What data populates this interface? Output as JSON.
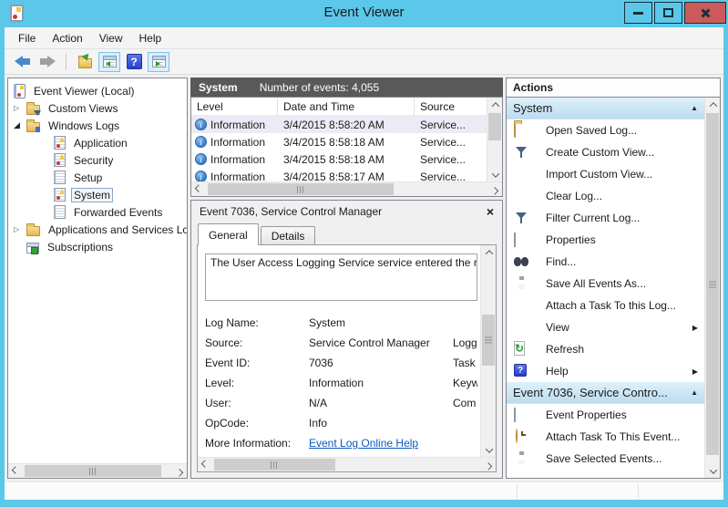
{
  "window": {
    "title": "Event Viewer"
  },
  "menu": {
    "items": [
      "File",
      "Action",
      "View",
      "Help"
    ]
  },
  "toolbar": {
    "icons": [
      "back-icon",
      "forward-icon",
      "export-log-icon",
      "show-console-tree-icon",
      "help-icon",
      "show-action-pane-icon"
    ]
  },
  "glyphs": {
    "expander_collapsed": "▷",
    "expander_expanded": "◢",
    "section_collapse": "▲",
    "submenu_arrow": "▶",
    "close_x": "×"
  },
  "colors": {
    "titlebar_blue": "#5bc8ea",
    "close_red": "#cc5a5a",
    "events_header_gray": "#595959",
    "section_header_blue": "#bcdcf0",
    "link_blue": "#0a59c0",
    "panel_border": "#828790"
  },
  "tree": {
    "items": [
      {
        "label": "Event Viewer (Local)",
        "icon": "event-viewer-icon"
      },
      {
        "label": "Custom Views",
        "icon": "folder-filter-icon",
        "state": "collapsed"
      },
      {
        "label": "Windows Logs",
        "icon": "folder-icon",
        "state": "expanded"
      },
      {
        "label": "Application",
        "icon": "log-icon"
      },
      {
        "label": "Security",
        "icon": "log-icon"
      },
      {
        "label": "Setup",
        "icon": "log-plain-icon"
      },
      {
        "label": "System",
        "icon": "log-icon",
        "selected": true
      },
      {
        "label": "Forwarded Events",
        "icon": "log-plain-icon"
      },
      {
        "label": "Applications and Services Lo",
        "icon": "folder-icon",
        "state": "collapsed"
      },
      {
        "label": "Subscriptions",
        "icon": "subscriptions-icon"
      }
    ]
  },
  "events": {
    "log_name": "System",
    "count_label": "Number of events: 4,055",
    "columns": [
      "Level",
      "Date and Time",
      "Source"
    ],
    "rows": [
      {
        "level": "Information",
        "datetime": "3/4/2015 8:58:20 AM",
        "source": "Service...",
        "selected": true
      },
      {
        "level": "Information",
        "datetime": "3/4/2015 8:58:18 AM",
        "source": "Service..."
      },
      {
        "level": "Information",
        "datetime": "3/4/2015 8:58:18 AM",
        "source": "Service..."
      },
      {
        "level": "Information",
        "datetime": "3/4/2015 8:58:17 AM",
        "source": "Service..."
      }
    ]
  },
  "detail": {
    "title": "Event 7036, Service Control Manager",
    "tabs": [
      "General",
      "Details"
    ],
    "active_tab": "General",
    "description": "The User Access Logging Service service entered the ru",
    "fields": [
      {
        "label": "Log Name:",
        "value": "System",
        "label2": ""
      },
      {
        "label": "Source:",
        "value": "Service Control Manager",
        "label2": "Logg"
      },
      {
        "label": "Event ID:",
        "value": "7036",
        "label2": "Task"
      },
      {
        "label": "Level:",
        "value": "Information",
        "label2": "Keyw"
      },
      {
        "label": "User:",
        "value": "N/A",
        "label2": "Com"
      },
      {
        "label": "OpCode:",
        "value": "Info",
        "label2": ""
      }
    ],
    "more_info_label": "More Information:",
    "more_info_link": "Event Log Online Help"
  },
  "actions": {
    "title": "Actions",
    "sections": [
      {
        "header": "System",
        "items": [
          {
            "label": "Open Saved Log...",
            "icon": "open-folder-icon"
          },
          {
            "label": "Create Custom View...",
            "icon": "filter-icon"
          },
          {
            "label": "Import Custom View...",
            "icon": "none"
          },
          {
            "label": "Clear Log...",
            "icon": "none"
          },
          {
            "label": "Filter Current Log...",
            "icon": "filter-icon"
          },
          {
            "label": "Properties",
            "icon": "properties-icon"
          },
          {
            "label": "Find...",
            "icon": "binoculars-icon"
          },
          {
            "label": "Save All Events As...",
            "icon": "save-icon"
          },
          {
            "label": "Attach a Task To this Log...",
            "icon": "none"
          },
          {
            "label": "View",
            "icon": "none",
            "submenu": true
          },
          {
            "label": "Refresh",
            "icon": "refresh-icon"
          },
          {
            "label": "Help",
            "icon": "help-icon",
            "submenu": true
          }
        ]
      },
      {
        "header": "Event 7036, Service Contro...",
        "items": [
          {
            "label": "Event Properties",
            "icon": "properties-icon"
          },
          {
            "label": "Attach Task To This Event...",
            "icon": "task-icon"
          },
          {
            "label": "Save Selected Events...",
            "icon": "save-icon"
          }
        ]
      }
    ]
  }
}
